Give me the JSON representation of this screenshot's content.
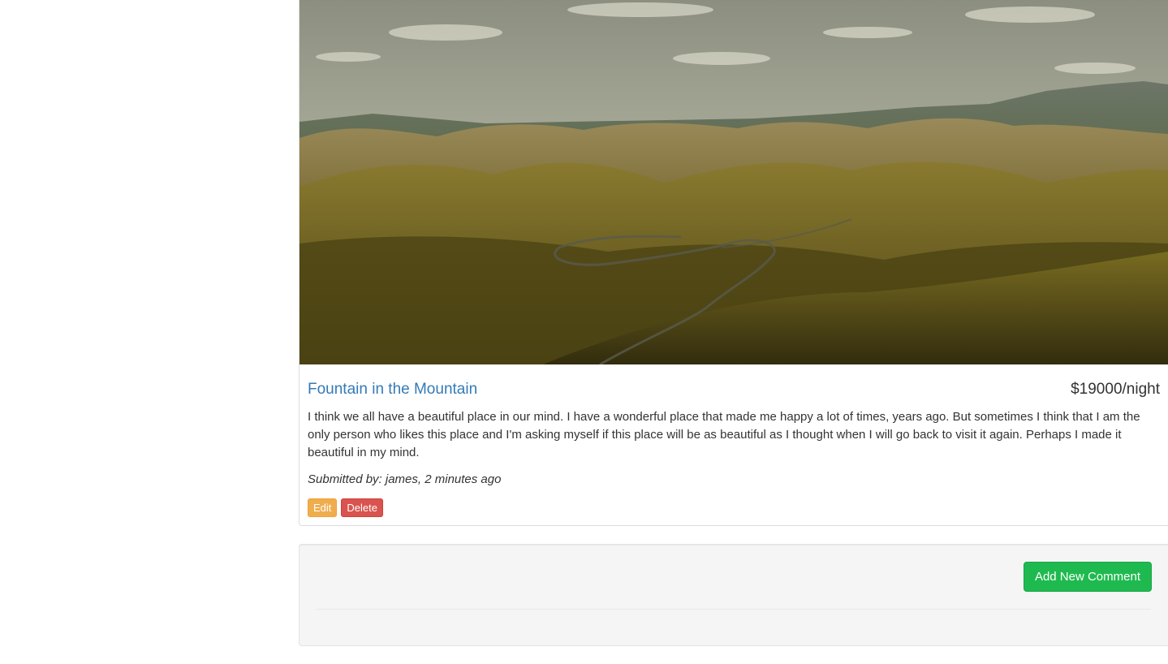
{
  "campground": {
    "image_alt": "Rolling golden hills with a winding road under a cloudy sky",
    "title": "Fountain in the Mountain",
    "price": "$19000/night",
    "description": "I think we all have a beautiful place in our mind. I have a wonderful place that made me happy a lot of times, years ago. But sometimes I think that I am the only person who likes this place and I'm asking myself if this place will be as beautiful as I thought when I will go back to visit it again. Perhaps I made it beautiful in my mind.",
    "submitted": "Submitted by: james, 2 minutes ago",
    "edit_label": "Edit",
    "delete_label": "Delete"
  },
  "comments": {
    "add_label": "Add New Comment"
  },
  "colors": {
    "link": "#337ab7",
    "warning": "#f0ad4e",
    "danger": "#d9534f",
    "success": "#1fba4f",
    "well": "#f5f5f5"
  }
}
